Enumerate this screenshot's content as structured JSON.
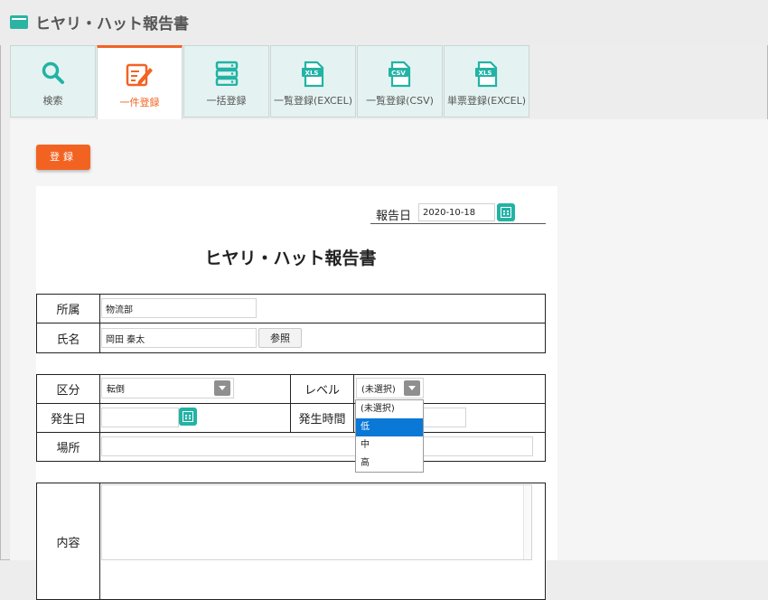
{
  "app": {
    "title": "ヒヤリ・ハット報告書"
  },
  "tabs": [
    {
      "label": "検索",
      "icon": "search-icon"
    },
    {
      "label": "一件登録",
      "icon": "edit-icon",
      "active": true
    },
    {
      "label": "一括登録",
      "icon": "database-icon"
    },
    {
      "label": "一覧登録(EXCEL)",
      "icon": "xls-file-icon",
      "badge": "XLS"
    },
    {
      "label": "一覧登録(CSV)",
      "icon": "csv-file-icon",
      "badge": "CSV"
    },
    {
      "label": "単票登録(EXCEL)",
      "icon": "xls-file-icon",
      "badge": "XLS"
    }
  ],
  "actions": {
    "register_label": "登録"
  },
  "form": {
    "report_date_label": "報告日",
    "report_date_value": "2020-10-18",
    "title": "ヒヤリ・ハット報告書",
    "affiliation_label": "所属",
    "affiliation_value": "物流部",
    "name_label": "氏名",
    "name_value": "岡田 秦太",
    "reference_button": "参照",
    "category_label": "区分",
    "category_value": "転倒",
    "level_label": "レベル",
    "level_value": "(未選択)",
    "level_options": [
      "(未選択)",
      "低",
      "中",
      "高"
    ],
    "level_highlighted": "低",
    "occurrence_date_label": "発生日",
    "occurrence_time_label": "発生時間",
    "location_label": "場所",
    "content_label": "内容"
  },
  "colors": {
    "accent": "#f26322",
    "teal": "#22b3a5",
    "selected": "#0a78d7"
  }
}
